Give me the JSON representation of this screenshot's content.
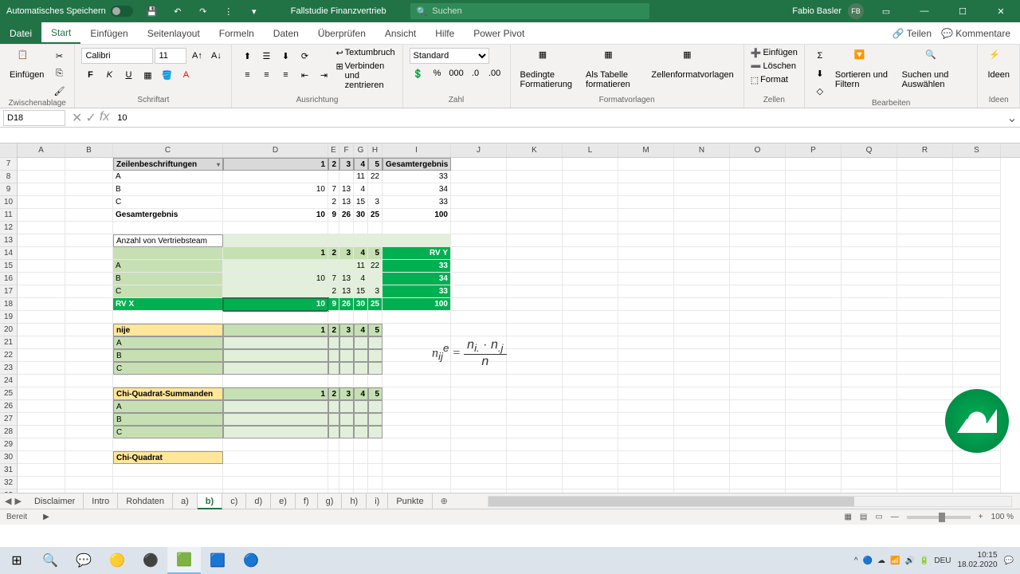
{
  "titlebar": {
    "autosave": "Automatisches Speichern",
    "doc": "Fallstudie Finanzvertrieb",
    "search_placeholder": "Suchen",
    "user": "Fabio Basler",
    "user_initials": "FB"
  },
  "tabs": {
    "file": "Datei",
    "start": "Start",
    "insert": "Einfügen",
    "layout": "Seitenlayout",
    "formulas": "Formeln",
    "data": "Daten",
    "review": "Überprüfen",
    "view": "Ansicht",
    "help": "Hilfe",
    "powerpivot": "Power Pivot",
    "share": "Teilen",
    "comments": "Kommentare"
  },
  "ribbon": {
    "paste": "Einfügen",
    "clipboard": "Zwischenablage",
    "font_name": "Calibri",
    "font_size": "11",
    "font_group": "Schriftart",
    "wrap": "Textumbruch",
    "merge": "Verbinden und zentrieren",
    "align_group": "Ausrichtung",
    "format": "Standard",
    "number_group": "Zahl",
    "cond": "Bedingte Formatierung",
    "table": "Als Tabelle formatieren",
    "cellstyle": "Zellenformatvorlagen",
    "styles_group": "Formatvorlagen",
    "ins": "Einfügen",
    "del": "Löschen",
    "fmt": "Format",
    "cells_group": "Zellen",
    "sort": "Sortieren und Filtern",
    "find": "Suchen und Auswählen",
    "edit_group": "Bearbeiten",
    "ideas": "Ideen",
    "ideas_group": "Ideen"
  },
  "namebox": "D18",
  "formula": "10",
  "cols": [
    "A",
    "B",
    "C",
    "D",
    "E",
    "F",
    "G",
    "H",
    "I",
    "J",
    "K",
    "L",
    "M",
    "N",
    "O",
    "P",
    "Q",
    "R",
    "S"
  ],
  "rows_start": 7,
  "rows_end": 33,
  "sheet": {
    "r7": {
      "C": "Zeilenbeschriftungen",
      "D": "1",
      "E": "2",
      "F": "3",
      "G": "4",
      "H": "5",
      "I": "Gesamtergebnis"
    },
    "r8": {
      "C": "A",
      "G": "11",
      "H": "22",
      "I": "33"
    },
    "r9": {
      "C": "B",
      "D": "10",
      "E": "7",
      "F": "13",
      "G": "4",
      "I": "34"
    },
    "r10": {
      "C": "C",
      "E": "2",
      "F": "13",
      "G": "15",
      "H": "3",
      "I": "33"
    },
    "r11": {
      "C": "Gesamtergebnis",
      "D": "10",
      "E": "9",
      "F": "26",
      "G": "30",
      "H": "25",
      "I": "100"
    },
    "r13": {
      "C": "Anzahl von Vertriebsteam"
    },
    "r14": {
      "D": "1",
      "E": "2",
      "F": "3",
      "G": "4",
      "H": "5",
      "I": "RV Y"
    },
    "r15": {
      "C": "A",
      "G": "11",
      "H": "22",
      "I": "33"
    },
    "r16": {
      "C": "B",
      "D": "10",
      "E": "7",
      "F": "13",
      "G": "4",
      "I": "34"
    },
    "r17": {
      "C": "C",
      "E": "2",
      "F": "13",
      "G": "15",
      "H": "3",
      "I": "33"
    },
    "r18": {
      "C": "RV X",
      "D": "10",
      "E": "9",
      "F": "26",
      "G": "30",
      "H": "25",
      "I": "100"
    },
    "r20": {
      "C": "nije",
      "D": "1",
      "E": "2",
      "F": "3",
      "G": "4",
      "H": "5"
    },
    "r21": {
      "C": "A"
    },
    "r22": {
      "C": "B"
    },
    "r23": {
      "C": "C"
    },
    "r25": {
      "C": "Chi-Quadrat-Summanden",
      "D": "1",
      "E": "2",
      "F": "3",
      "G": "4",
      "H": "5"
    },
    "r26": {
      "C": "A"
    },
    "r27": {
      "C": "B"
    },
    "r28": {
      "C": "C"
    },
    "r30": {
      "C": "Chi-Quadrat"
    }
  },
  "sheets": [
    "Disclaimer",
    "Intro",
    "Rohdaten",
    "a)",
    "b)",
    "c)",
    "d)",
    "e)",
    "f)",
    "g)",
    "h)",
    "i)",
    "Punkte"
  ],
  "active_sheet": "b)",
  "status": "Bereit",
  "zoom": "100 %",
  "clock": {
    "time": "10:15",
    "date": "18.02.2020"
  }
}
